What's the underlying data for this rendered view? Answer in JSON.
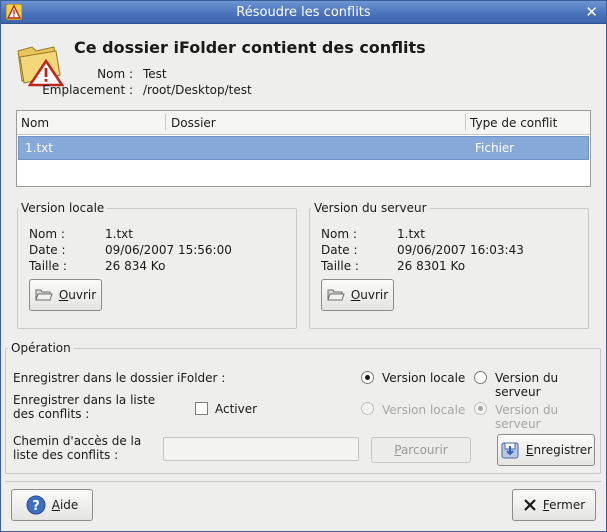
{
  "window": {
    "title": "Résoudre les conflits",
    "close_glyph": "✕"
  },
  "header": {
    "heading": "Ce dossier iFolder contient des conflits",
    "name_label": "Nom :",
    "name_value": "Test",
    "location_label": "Emplacement :",
    "location_value": "/root/Desktop/test"
  },
  "table": {
    "columns": [
      "Nom",
      "Dossier",
      "Type de conflit"
    ],
    "rows": [
      {
        "name": "1.txt",
        "folder": "",
        "type": "Fichier"
      }
    ]
  },
  "local": {
    "title": "Version locale",
    "name_label": "Nom :",
    "name_value": "1.txt",
    "date_label": "Date :",
    "date_value": "09/06/2007 15:56:00",
    "size_label": "Taille :",
    "size_value": "26 834 Ko",
    "open_prefix": "",
    "open_mnemonic": "O",
    "open_rest": "uvrir"
  },
  "server": {
    "title": "Version du serveur",
    "name_label": "Nom :",
    "name_value": "1.txt",
    "date_label": "Date :",
    "date_value": "09/06/2007 16:03:43",
    "size_label": "Taille :",
    "size_value": "26 8301 Ko",
    "open_prefix": "",
    "open_mnemonic": "O",
    "open_rest": "uvrir"
  },
  "operation": {
    "title": "Opération",
    "save_in_ifolder_label": "Enregistrer dans le dossier iFolder :",
    "opt_local": "Version locale",
    "opt_server": "Version du serveur",
    "save_in_list_label_1": "Enregistrer dans la liste",
    "save_in_list_label_2": "des conflits :",
    "activate_label": "Activer",
    "path_label_1": "Chemin d'accès de la",
    "path_label_2": "liste des conflits :",
    "path_value": "",
    "browse_prefix": "",
    "browse_mnemonic": "P",
    "browse_rest": "arcourir",
    "save_prefix": "",
    "save_mnemonic": "E",
    "save_rest": "nregistrer"
  },
  "footer": {
    "help_prefix": "",
    "help_mnemonic": "A",
    "help_rest": "ide",
    "close_prefix": "",
    "close_mnemonic": "F",
    "close_rest": "ermer"
  }
}
